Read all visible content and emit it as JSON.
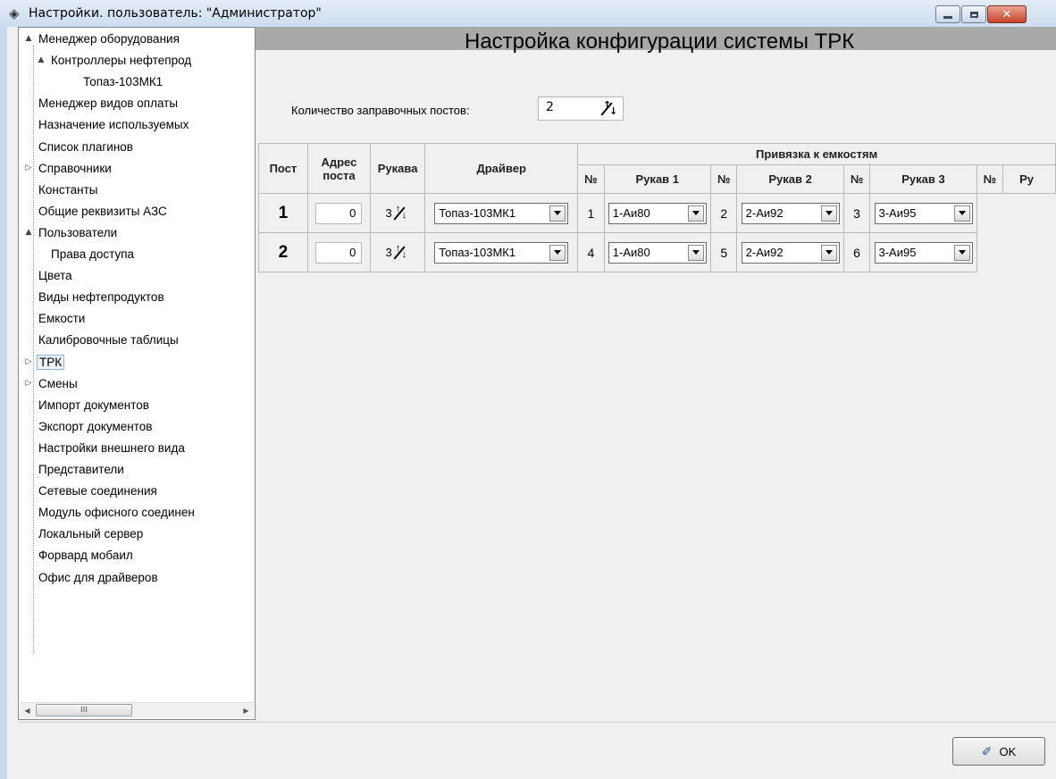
{
  "window": {
    "title": "Настройки. пользователь: \"Администратор\"",
    "icon": "gear-diamond-icon"
  },
  "tree": {
    "items": [
      {
        "label": "Менеджер оборудования",
        "expander": "▲"
      },
      {
        "label": "Контроллеры нефтепрод",
        "expander": "▲"
      },
      {
        "label": "Топаз-103МК1"
      },
      {
        "label": "Менеджер видов оплаты"
      },
      {
        "label": "Назначение используемых"
      },
      {
        "label": "Список плагинов"
      },
      {
        "label": "Справочники",
        "expander": "▷"
      },
      {
        "label": "Константы"
      },
      {
        "label": "Общие реквизиты АЗС"
      },
      {
        "label": "Пользователи",
        "expander": "▲"
      },
      {
        "label": "Права доступа"
      },
      {
        "label": "Цвета"
      },
      {
        "label": "Виды нефтепродуктов"
      },
      {
        "label": "Емкости"
      },
      {
        "label": "Калибровочные таблицы"
      },
      {
        "label": "ТРК",
        "expander": "▷",
        "selected": true
      },
      {
        "label": "Смены",
        "expander": "▷"
      },
      {
        "label": "Импорт документов"
      },
      {
        "label": "Экспорт документов"
      },
      {
        "label": "Настройки внешнего вида"
      },
      {
        "label": "Представители"
      },
      {
        "label": "Сетевые соединения"
      },
      {
        "label": "Модуль офисного соединен"
      },
      {
        "label": "Локальный сервер"
      },
      {
        "label": "Форвард мобаил"
      },
      {
        "label": "Офис для драйверов"
      }
    ],
    "scroll_thumb_label": "III"
  },
  "main": {
    "title": "Настройка конфигурации системы ТРК",
    "count_label": "Количество заправочных постов:",
    "count_value": "2"
  },
  "table": {
    "headers": {
      "post": "Пост",
      "address_line1": "Адрес",
      "address_line2": "поста",
      "hoses": "Рукава",
      "driver": "Драйвер",
      "binding": "Привязка к емкостям",
      "num": "№",
      "hose1": "Рукав 1",
      "hose2": "Рукав 2",
      "hose3": "Рукав 3",
      "hose4_partial": "Ру"
    },
    "rows": [
      {
        "post": "1",
        "address": "0",
        "hoses": "3",
        "driver": "Топаз-103МК1",
        "links": [
          {
            "num": "1",
            "value": "1-Аи80"
          },
          {
            "num": "2",
            "value": "2-Аи92"
          },
          {
            "num": "3",
            "value": "3-Аи95"
          }
        ]
      },
      {
        "post": "2",
        "address": "0",
        "hoses": "3",
        "driver": "Топаз-103МК1",
        "links": [
          {
            "num": "4",
            "value": "1-Аи80"
          },
          {
            "num": "5",
            "value": "2-Аи92"
          },
          {
            "num": "6",
            "value": "3-Аи95"
          }
        ]
      }
    ]
  },
  "footer": {
    "ok_label": "OK"
  }
}
